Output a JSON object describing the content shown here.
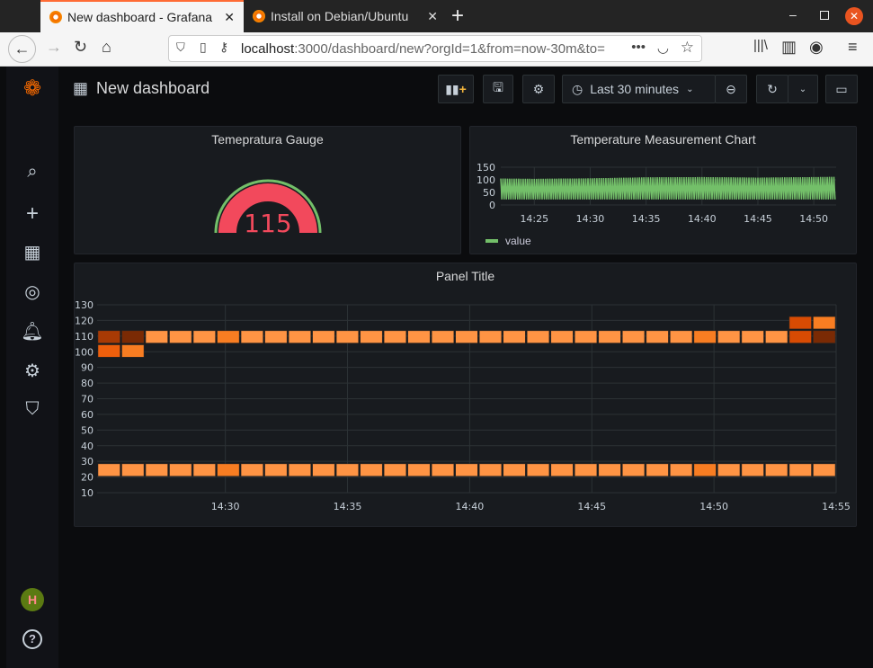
{
  "browser": {
    "tabs": [
      {
        "title": "New dashboard - Grafana",
        "active": true
      },
      {
        "title": "Install on Debian/Ubuntu",
        "active": false
      }
    ],
    "new_tab": "+",
    "url_host": "localhost",
    "url_rest": ":3000/dashboard/new?orgId=1&from=now-30m&to=",
    "window_controls": [
      "minimize",
      "maximize",
      "close"
    ]
  },
  "dashboard": {
    "title": "New dashboard",
    "time_range": "Last 30 minutes",
    "toolbar_icons": [
      "add-panel",
      "save",
      "settings",
      "clock",
      "zoom-out",
      "refresh",
      "chevron-down",
      "tv-mode"
    ]
  },
  "sidebar": {
    "items": [
      "search",
      "create",
      "dashboards",
      "explore",
      "alerting",
      "configuration",
      "server-admin",
      "profile",
      "help"
    ]
  },
  "gauge": {
    "title": "Temepratura Gauge",
    "value": "115",
    "color": "#f2495c",
    "threshold_color": "#73bf69"
  },
  "line_chart": {
    "title": "Temperature Measurement Chart",
    "legend": "value"
  },
  "heatmap_panel": {
    "title": "Panel Title"
  },
  "chart_data": [
    {
      "type": "area",
      "title": "Temperature Measurement Chart",
      "series": [
        {
          "name": "value",
          "color": "#73bf69",
          "x": [
            "14:22",
            "14:25",
            "14:30",
            "14:35",
            "14:40",
            "14:45",
            "14:50",
            "14:52"
          ],
          "low": [
            22,
            22,
            22,
            22,
            22,
            22,
            22,
            22
          ],
          "high": [
            105,
            104,
            106,
            110,
            111,
            109,
            111,
            112
          ]
        }
      ],
      "ylim": [
        0,
        150
      ],
      "yticks": [
        "150",
        "100",
        "50",
        "0"
      ],
      "xticks": [
        "14:25",
        "14:30",
        "14:35",
        "14:40",
        "14:45",
        "14:50"
      ],
      "grid": true,
      "legend": "bottom-left"
    },
    {
      "type": "heatmap",
      "title": "Panel Title",
      "ylim": [
        10,
        130
      ],
      "yticks": [
        "130",
        "120",
        "110",
        "100",
        "90",
        "80",
        "70",
        "60",
        "50",
        "40",
        "30",
        "20",
        "10"
      ],
      "xticks": [
        "14:30",
        "14:35",
        "14:40",
        "14:45",
        "14:50",
        "14:55"
      ],
      "x_start": "14:25",
      "x_end": "14:55",
      "bucket_minutes": 1,
      "bucket_size": 9,
      "cells": [
        {
          "bucket": 105,
          "counts": [
            2,
            1,
            6,
            6,
            6,
            5,
            6,
            6,
            6,
            6,
            6,
            6,
            6,
            6,
            6,
            6,
            6,
            6,
            6,
            6,
            6,
            6,
            6,
            6,
            6,
            5,
            6,
            6,
            6,
            3,
            1
          ]
        },
        {
          "bucket": 96,
          "counts": [
            4,
            5,
            0,
            0,
            0,
            0,
            0,
            0,
            0,
            0,
            0,
            0,
            0,
            0,
            0,
            0,
            0,
            0,
            0,
            0,
            0,
            0,
            0,
            0,
            0,
            0,
            0,
            0,
            0,
            0,
            0
          ]
        },
        {
          "bucket": 114,
          "counts": [
            0,
            0,
            0,
            0,
            0,
            0,
            0,
            0,
            0,
            0,
            0,
            0,
            0,
            0,
            0,
            0,
            0,
            0,
            0,
            0,
            0,
            0,
            0,
            0,
            0,
            0,
            0,
            0,
            0,
            3,
            5
          ]
        },
        {
          "bucket": 20,
          "counts": [
            6,
            6,
            6,
            6,
            6,
            5,
            6,
            6,
            6,
            6,
            6,
            6,
            6,
            6,
            6,
            6,
            6,
            6,
            6,
            6,
            6,
            6,
            6,
            6,
            6,
            5,
            6,
            6,
            6,
            6,
            6
          ]
        }
      ],
      "color_scheme": [
        "#7a2a04",
        "#a83a04",
        "#d84b03",
        "#ee5f0c",
        "#f87d22",
        "#ff9444"
      ],
      "grid": true
    }
  ]
}
